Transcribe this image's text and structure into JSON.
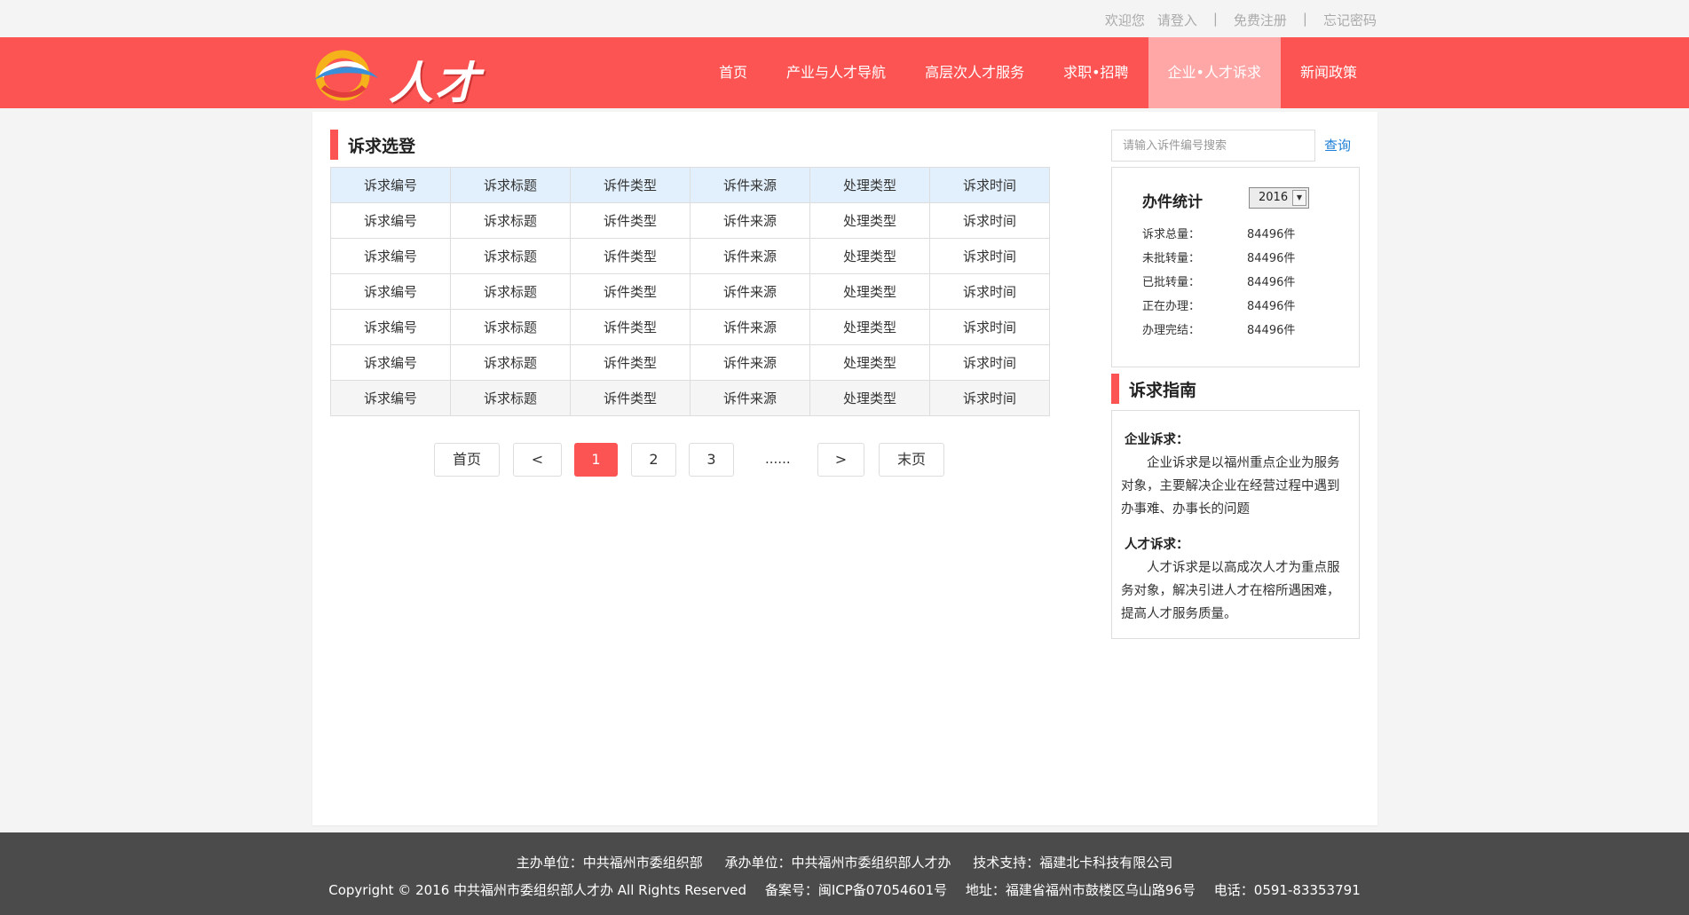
{
  "topbar": {
    "welcome": "欢迎您",
    "login": "请登入",
    "sep1": "|",
    "register": "免费注册",
    "sep2": "|",
    "forgot": "忘记密码"
  },
  "brand": {
    "logo_text": "人才"
  },
  "nav": [
    {
      "label": "首页"
    },
    {
      "label": "产业与人才导航"
    },
    {
      "label": "高层次人才服务"
    },
    {
      "label": "求职•招聘"
    },
    {
      "label": "企业•人才诉求"
    },
    {
      "label": "新闻政策"
    }
  ],
  "left": {
    "title": "诉求选登",
    "rows": [
      [
        "诉求编号",
        "诉求标题",
        "诉件类型",
        "诉件来源",
        "处理类型",
        "诉求时间"
      ],
      [
        "诉求编号",
        "诉求标题",
        "诉件类型",
        "诉件来源",
        "处理类型",
        "诉求时间"
      ],
      [
        "诉求编号",
        "诉求标题",
        "诉件类型",
        "诉件来源",
        "处理类型",
        "诉求时间"
      ],
      [
        "诉求编号",
        "诉求标题",
        "诉件类型",
        "诉件来源",
        "处理类型",
        "诉求时间"
      ],
      [
        "诉求编号",
        "诉求标题",
        "诉件类型",
        "诉件来源",
        "处理类型",
        "诉求时间"
      ],
      [
        "诉求编号",
        "诉求标题",
        "诉件类型",
        "诉件来源",
        "处理类型",
        "诉求时间"
      ],
      [
        "诉求编号",
        "诉求标题",
        "诉件类型",
        "诉件来源",
        "处理类型",
        "诉求时间"
      ]
    ]
  },
  "pager": {
    "first": "首页",
    "prev": "<",
    "p1": "1",
    "p2": "2",
    "p3": "3",
    "dots": "......",
    "next": ">",
    "last": "末页"
  },
  "search": {
    "placeholder": "请输入诉件编号搜索",
    "button": "查询"
  },
  "stats": {
    "title": "办件统计",
    "year": "2016",
    "items": [
      {
        "k": "诉求总量：",
        "v": "84496件"
      },
      {
        "k": "未批转量：",
        "v": "84496件"
      },
      {
        "k": "已批转量：",
        "v": "84496件"
      },
      {
        "k": "正在办理：",
        "v": "84496件"
      },
      {
        "k": "办理完结：",
        "v": "84496件"
      }
    ]
  },
  "guide": {
    "title": "诉求指南",
    "s1_title": "企业诉求：",
    "s1_text": "企业诉求是以福州重点企业为服务对象，主要解决企业在经营过程中遇到办事难、办事长的问题",
    "s2_title": "人才诉求：",
    "s2_text": "人才诉求是以高成次人才为重点服务对象，解决引进人才在榕所遇困难，提高人才服务质量。"
  },
  "footer": {
    "host": "主办单位：中共福州市委组织部",
    "organizer": "承办单位：中共福州市委组织部人才办",
    "support": "技术支持：福建北卡科技有限公司",
    "copyright": "Copyright © 2016 中共福州市委组织部人才办 All Rights Reserved",
    "icp": "备案号：闽ICP备07054601号",
    "address": "地址：福建省福州市鼓楼区乌山路96号",
    "phone": "电话：0591-83353791"
  },
  "colors": {
    "brand_red": "#fc5353",
    "nav_active": "#ffa6a6",
    "table_head": "#e2f0fd",
    "link_blue": "#1e7fd6",
    "footer_bg": "#4b4b4b"
  }
}
